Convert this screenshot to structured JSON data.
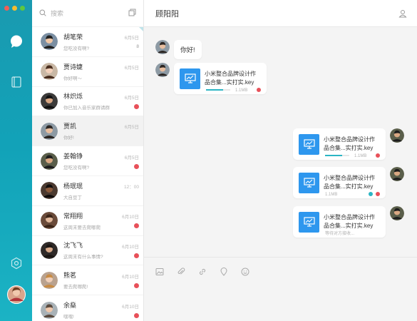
{
  "window_controls": {
    "colors": [
      "#ee5f57",
      "#f5bc2f",
      "#5fc73e"
    ]
  },
  "rail": {
    "icons": [
      "chat-bubble-icon",
      "notebook-icon",
      "hexagon-icon",
      "avatar"
    ]
  },
  "search": {
    "placeholder": "搜索"
  },
  "conversations": [
    {
      "name": "胡笔荣",
      "preview": "您吃没有啊?",
      "time": "6月5日",
      "count": "8"
    },
    {
      "name": "贾诗婕",
      "preview": "你好啊～",
      "time": "6月5日",
      "count": ""
    },
    {
      "name": "林炽烁",
      "preview": "你已加入音乐家群请群",
      "time": "6月5日",
      "count": "",
      "badge": true
    },
    {
      "name": "贾凯",
      "preview": "你好!",
      "time": "6月5日",
      "count": "",
      "active": true
    },
    {
      "name": "姜翰铮",
      "preview": "您吃没有啊?",
      "time": "6月5日",
      "count": "",
      "badge": true
    },
    {
      "name": "杨珉珉",
      "preview": "大自豆丁",
      "time": "12：00",
      "count": ""
    },
    {
      "name": "常翔翔",
      "preview": "这周末要去爬哪爬",
      "time": "6月10日",
      "count": "",
      "badge": true
    },
    {
      "name": "沈飞飞",
      "preview": "这周末有什么事情?",
      "time": "6月10日",
      "count": "",
      "badge": true
    },
    {
      "name": "熊茗",
      "preview": "要去爬哪爬!",
      "time": "6月10日",
      "count": "",
      "badge": true
    },
    {
      "name": "余燊",
      "preview": "嘿嘿!",
      "time": "6月10日",
      "count": "",
      "badge": true
    }
  ],
  "chat": {
    "title": "顾阳阳",
    "messages": [
      {
        "side": "left",
        "type": "text",
        "text": "你好!"
      },
      {
        "side": "left",
        "type": "file",
        "name": "小米整合品牌设计作品合集...实打实.key",
        "size": "1.1MB",
        "progress": 0.7,
        "status": "error"
      },
      {
        "side": "right",
        "type": "file",
        "name": "小米整合品牌设计作品合集...实打实.key",
        "size": "1.1MB",
        "progress": 0.7,
        "status": "error"
      },
      {
        "side": "right",
        "type": "file",
        "name": "小米整合品牌设计作品合集...实打实.key",
        "size": "1.1MB",
        "status": "done"
      },
      {
        "side": "right",
        "type": "file",
        "name": "小米整合品牌设计作品合集...实打实.key",
        "size": "等待对方接收...",
        "status": "waiting"
      }
    ]
  },
  "composer": {
    "tools": [
      "image-icon",
      "attachment-icon",
      "link-icon",
      "location-icon",
      "emoji-icon"
    ]
  }
}
